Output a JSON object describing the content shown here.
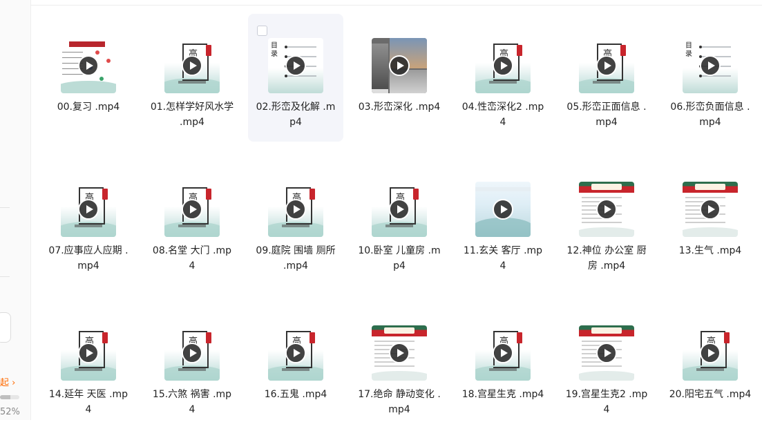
{
  "sidebar": {
    "collapse_label": "起 ›",
    "progress_percent": 52,
    "progress_label": "52%"
  },
  "files": [
    {
      "name": "00.复习 .mp4",
      "thumb": "diagram"
    },
    {
      "name": "01.怎样学好风水学 .mp4",
      "thumb": "ink"
    },
    {
      "name": "02.形峦及化解 .mp4",
      "thumb": "toc",
      "hover": true
    },
    {
      "name": "03.形峦深化 .mp4",
      "thumb": "photo"
    },
    {
      "name": "04.性峦深化2 .mp4",
      "thumb": "ink"
    },
    {
      "name": "05.形峦正面信息 .mp4",
      "thumb": "ink"
    },
    {
      "name": "06.形峦负面信息 .mp4",
      "thumb": "toc"
    },
    {
      "name": "07.应事应人应期 .mp4",
      "thumb": "ink"
    },
    {
      "name": "08.名堂 大门 .mp4",
      "thumb": "ink"
    },
    {
      "name": "09.庭院 围墙 厕所 .mp4",
      "thumb": "ink"
    },
    {
      "name": "10.卧室 儿童房 .mp4",
      "thumb": "ink"
    },
    {
      "name": "11.玄关 客厅 .mp4",
      "thumb": "scene"
    },
    {
      "name": "12.神位 办公室 厨房 .mp4",
      "thumb": "doc"
    },
    {
      "name": "13.生气 .mp4",
      "thumb": "doc"
    },
    {
      "name": "14.延年 天医 .mp4",
      "thumb": "ink"
    },
    {
      "name": "15.六煞 祸害 .mp4",
      "thumb": "ink"
    },
    {
      "name": "16.五鬼 .mp4",
      "thumb": "ink"
    },
    {
      "name": "17.绝命 静动变化 .mp4",
      "thumb": "doc"
    },
    {
      "name": "18.宫星生克 .mp4",
      "thumb": "ink"
    },
    {
      "name": "19.宫星生克2 .mp4",
      "thumb": "doc"
    },
    {
      "name": "20.阳宅五气 .mp4",
      "thumb": "ink"
    }
  ],
  "thumb_text": {
    "ink_char": "高",
    "toc_chars": "目录"
  },
  "colors": {
    "accent": "#ff6a00",
    "seal_red": "#c8252c",
    "hover_bg": "#f4f5fa"
  }
}
